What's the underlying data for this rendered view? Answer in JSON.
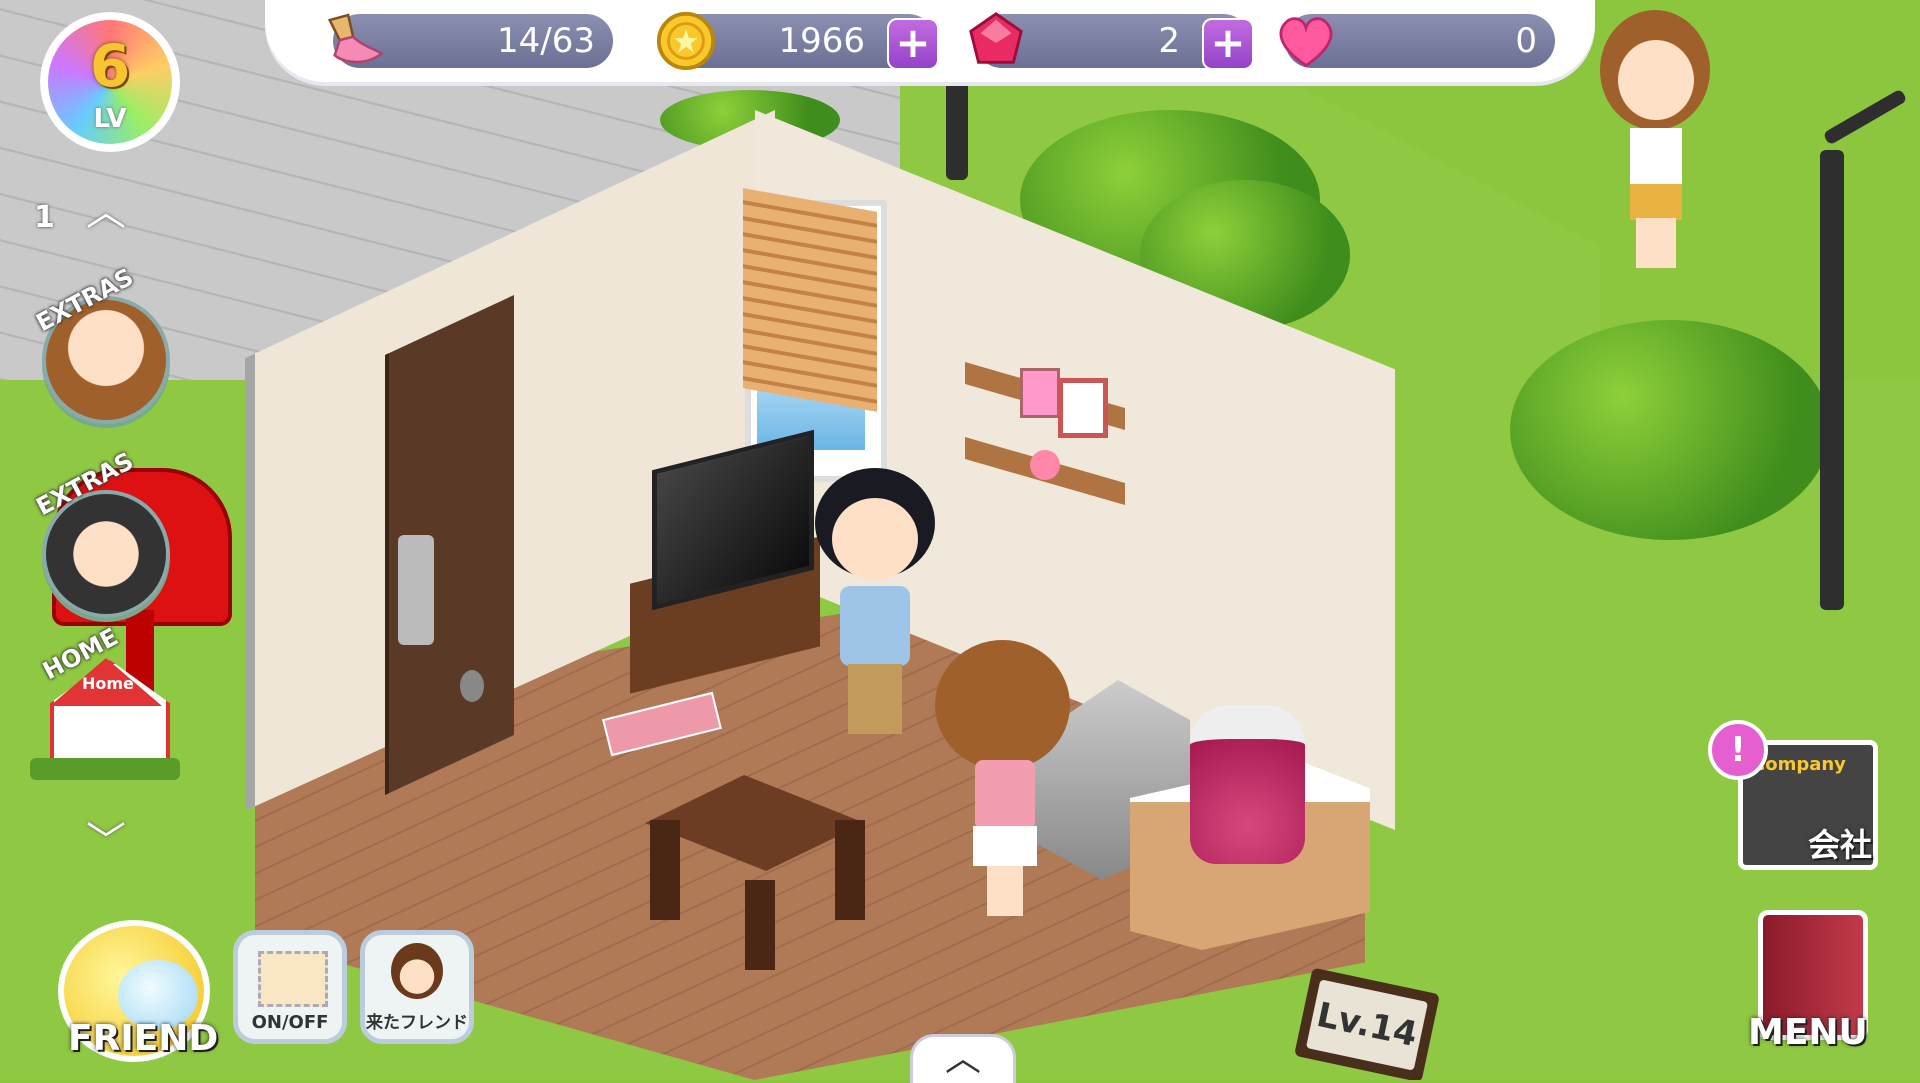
{
  "hud": {
    "paint": {
      "value": "14/63",
      "icon": "paintbrush-icon"
    },
    "coins": {
      "value": "1966",
      "icon": "gold-coin-icon",
      "add_label": "+"
    },
    "gems": {
      "value": "2",
      "icon": "ruby-gem-icon",
      "add_label": "+"
    },
    "hearts": {
      "value": "0",
      "icon": "heart-icon"
    }
  },
  "level": {
    "number": "6",
    "label": "LV"
  },
  "side_menu": {
    "floor_number": "1",
    "extras_label_1": "EXTRAS",
    "extras_label_2": "EXTRAS",
    "home_label": "HOME",
    "home_sign": "Home"
  },
  "bottom": {
    "friend_label": "FRIEND",
    "onoff_label": "ON/OFF",
    "visited_friend_label": "来たフレンド",
    "menu_label": "MENU",
    "company_label": "会社",
    "company_sign": "Company",
    "room_level": "Lv.14"
  },
  "colors": {
    "grass": "#8fc842",
    "hud_pill": "#7a7ea2",
    "plus": "#a052d3"
  }
}
